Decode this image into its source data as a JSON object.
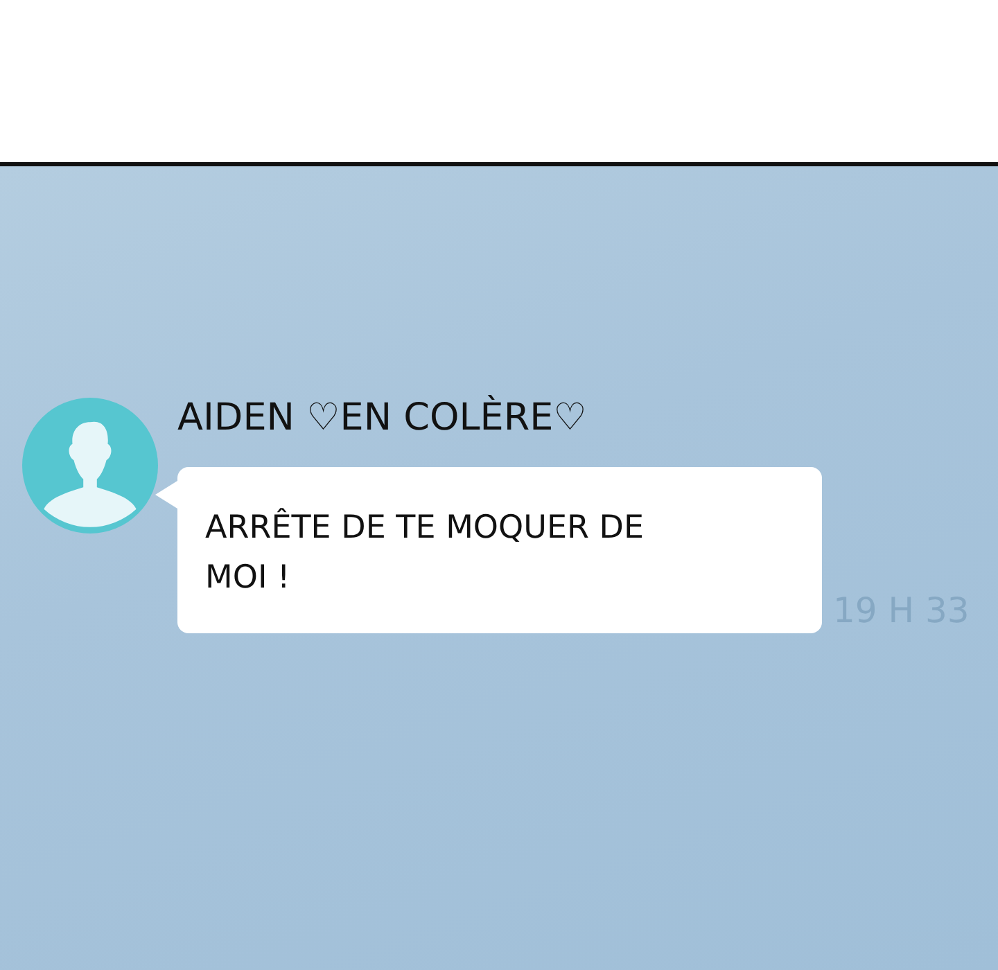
{
  "message": {
    "sender": "AIDEN ♡EN COLÈRE♡",
    "text": "ARRÊTE DE TE MOQUER DE MOI !",
    "time": "19 H 33"
  }
}
